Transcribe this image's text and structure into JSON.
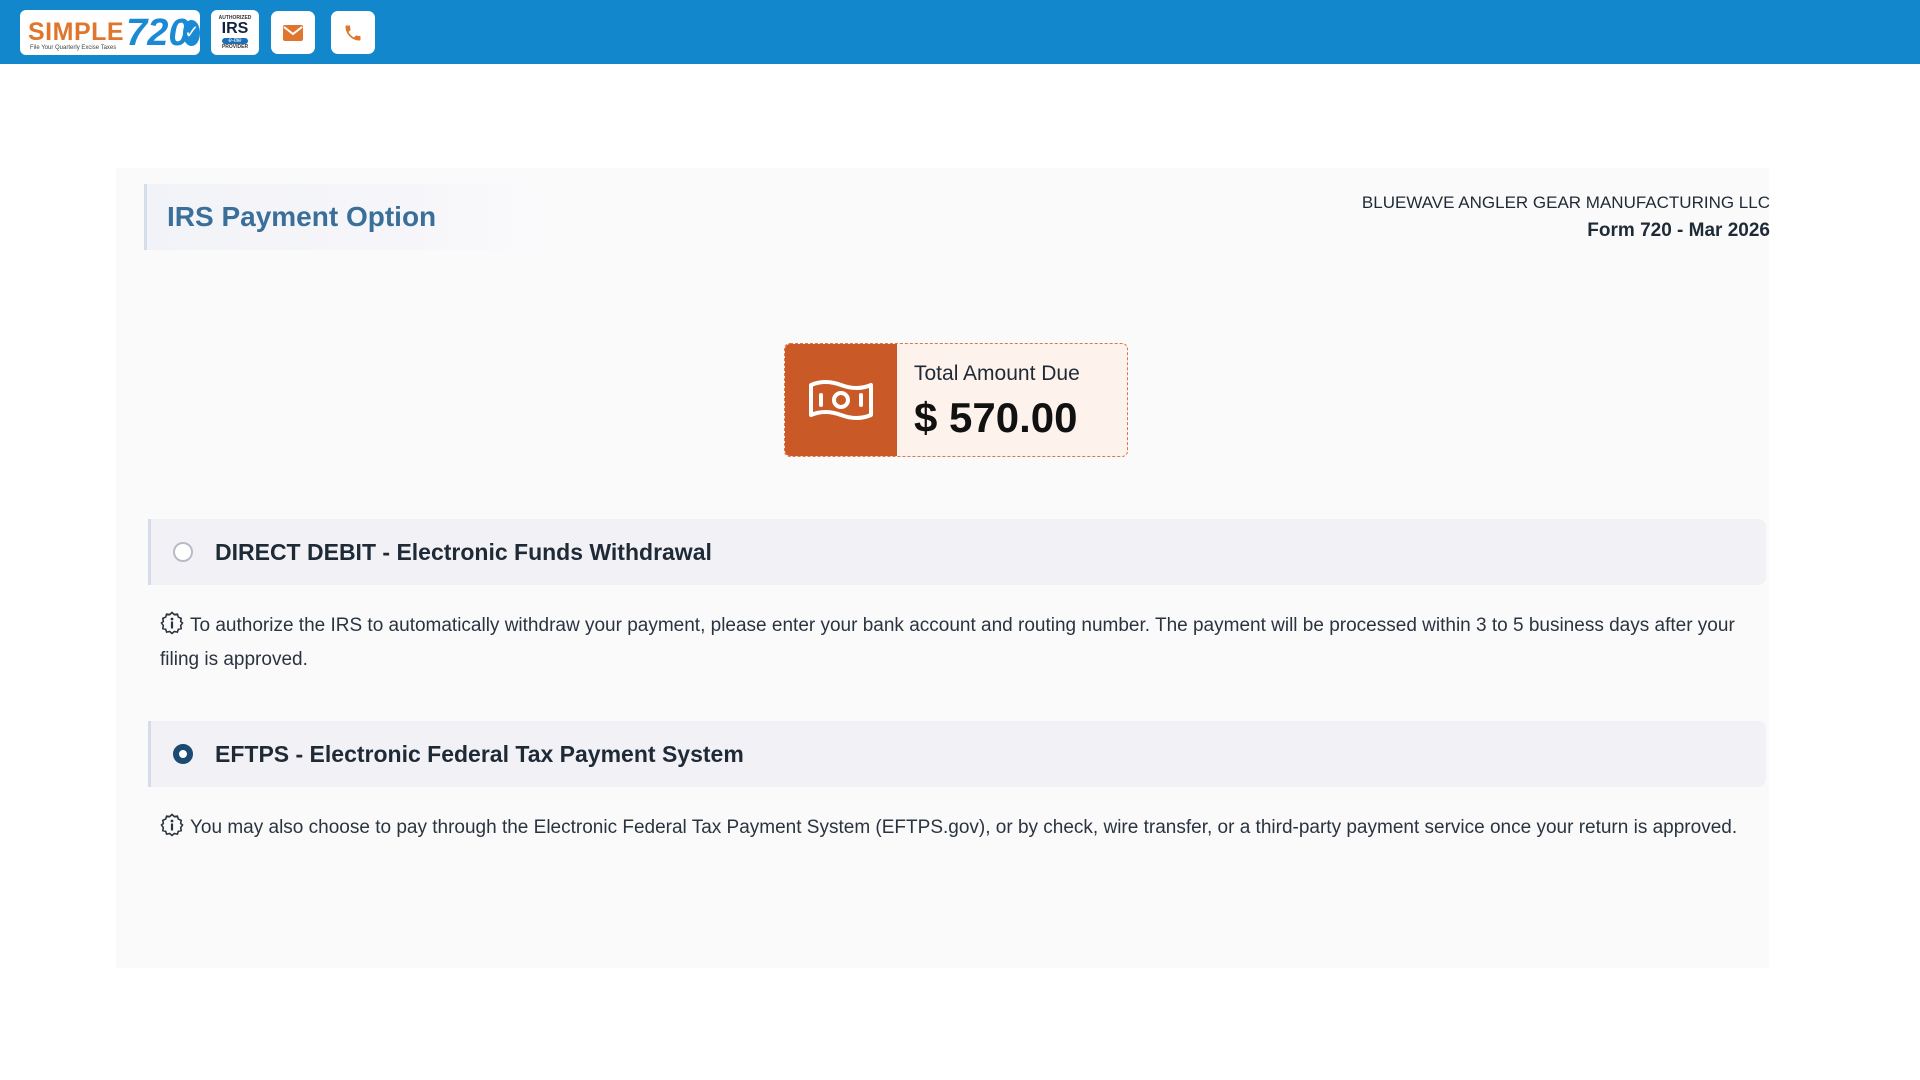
{
  "header": {
    "logo": {
      "word": "SIMPLE",
      "number": "720",
      "tagline": "File Your Quarterly Excise Taxes"
    },
    "irs_badge": {
      "top": "AUTHORIZED",
      "main": "IRS",
      "pill": "e-file",
      "bottom": "PROVIDER"
    },
    "email_icon": "envelope-icon",
    "phone_icon": "phone-icon",
    "bar_color": "#1287cc"
  },
  "page": {
    "title": "IRS Payment Option",
    "company": "BLUEWAVE ANGLER GEAR MANUFACTURING LLC",
    "form_label": "Form 720 - Mar 2026"
  },
  "amount": {
    "label": "Total Amount Due",
    "value": "$ 570.00",
    "icon": "money-bill-icon",
    "accent": "#c95a28"
  },
  "options": [
    {
      "label": "DIRECT DEBIT - Electronic Funds Withdrawal",
      "selected": false,
      "note": "To authorize the IRS to automatically withdraw your payment, please enter your bank account and routing number. The payment will be processed within 3 to 5 business days after your filing is approved."
    },
    {
      "label": "EFTPS - Electronic Federal Tax Payment System",
      "selected": true,
      "note": "You may also choose to pay through the Electronic Federal Tax Payment System (EFTPS.gov), or by check, wire transfer, or a third-party payment service once your return is approved."
    }
  ]
}
